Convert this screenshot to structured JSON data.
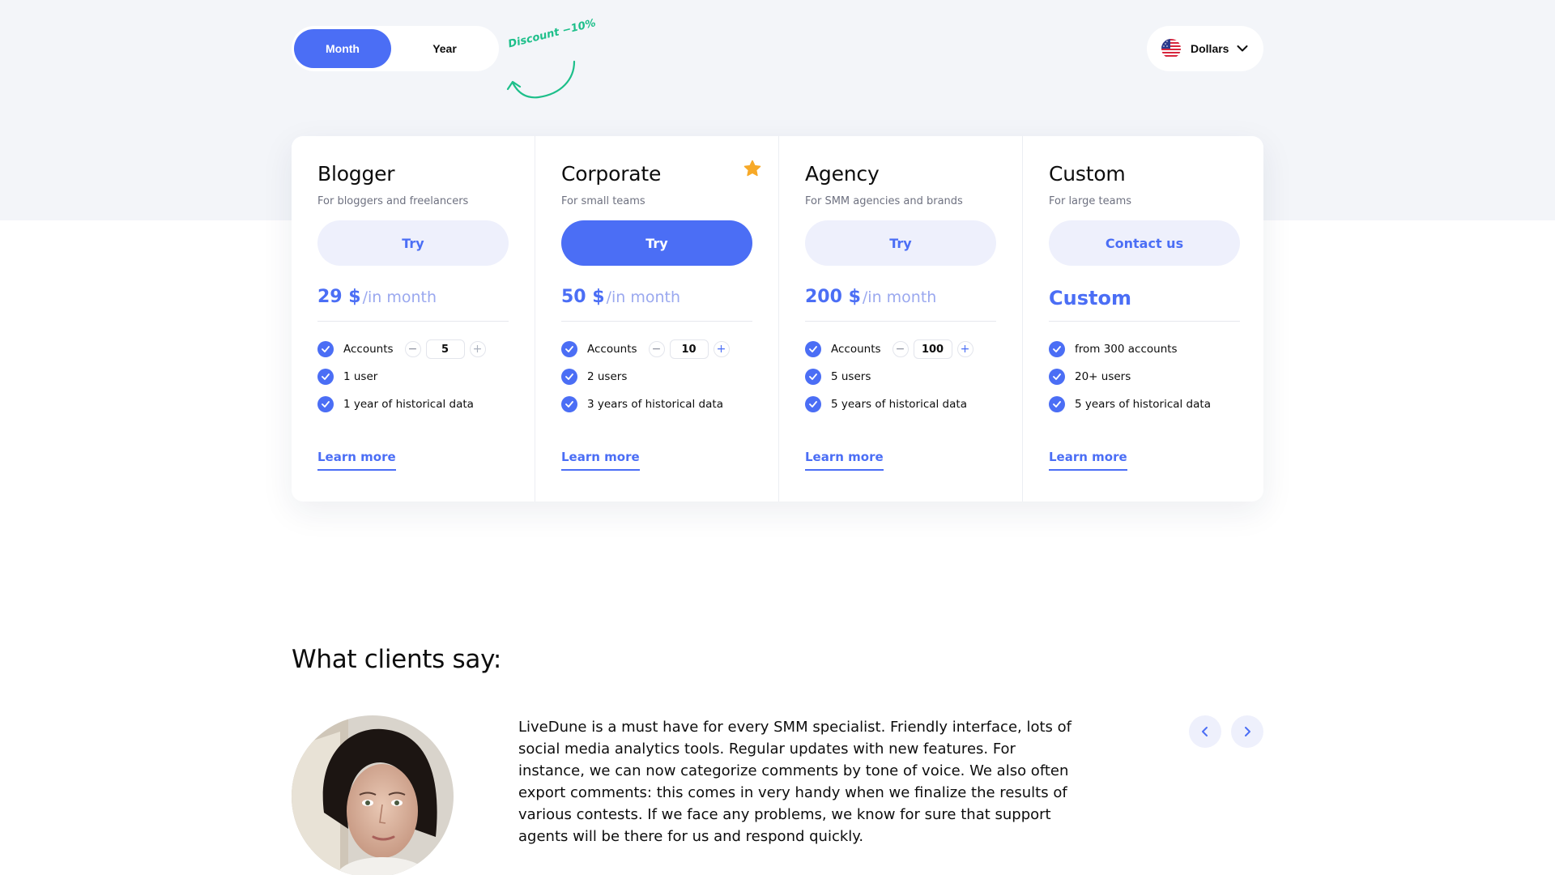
{
  "billing": {
    "month_label": "Month",
    "year_label": "Year",
    "discount_note": "Discount −10%"
  },
  "currency": {
    "label": "Dollars",
    "flag": "us-flag-icon"
  },
  "plans": [
    {
      "name": "Blogger",
      "description": "For bloggers and freelancers",
      "button_label": "Try",
      "price": "29 $",
      "price_unit": "/in month",
      "accounts_label": "Accounts",
      "accounts_value": "5",
      "features": [
        "1 user",
        "1 year of historical data"
      ],
      "learn_more": "Learn more"
    },
    {
      "name": "Corporate",
      "description": "For small teams",
      "button_label": "Try",
      "price": "50 $",
      "price_unit": "/in month",
      "accounts_label": "Accounts",
      "accounts_value": "10",
      "features": [
        "2 users",
        "3 years of historical data"
      ],
      "learn_more": "Learn more",
      "featured_icon": "star-icon"
    },
    {
      "name": "Agency",
      "description": "For SMM agencies and brands",
      "button_label": "Try",
      "price": "200 $",
      "price_unit": "/in month",
      "accounts_label": "Accounts",
      "accounts_value": "100",
      "features": [
        "5 users",
        "5 years of historical data"
      ],
      "learn_more": "Learn more"
    },
    {
      "name": "Custom",
      "description": "For large teams",
      "button_label": "Contact us",
      "price": "Custom",
      "features": [
        "from 300 accounts",
        "20+ users",
        "5 years of historical data"
      ],
      "learn_more": "Learn more"
    }
  ],
  "testimonials": {
    "title": "What clients say:",
    "quote": "LiveDune is a must have for every SMM specialist. Friendly interface, lots of social media analytics tools. Regular updates with new features. For instance, we can now categorize comments by tone of voice. We also often export comments: this comes in very handy when we finalize the results of various contests. If we face any problems, we know for sure that support agents will be there for us and respond quickly.",
    "prev_icon": "chevron-left-icon",
    "next_icon": "chevron-right-icon"
  },
  "colors": {
    "accent": "#4b6ef5",
    "accent_light": "#eef0fc",
    "discount": "#1dbf8a",
    "star": "#f7a928",
    "band": "#f3f5f9"
  }
}
